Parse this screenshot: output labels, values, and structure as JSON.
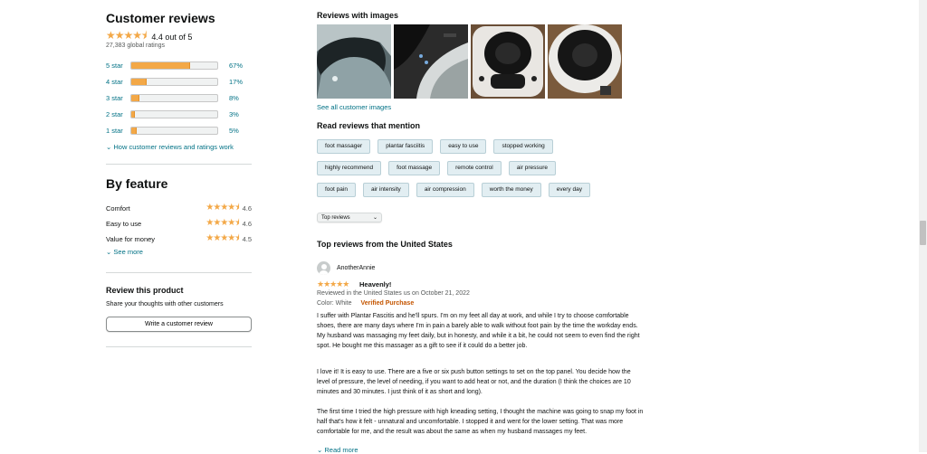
{
  "reviews": {
    "title": "Customer reviews",
    "rating_text": "4.4 out of 5",
    "rating": 4.4,
    "global_ratings": "27,383 global ratings",
    "histogram": [
      {
        "label": "5 star",
        "percent": 67,
        "pct_text": "67%"
      },
      {
        "label": "4 star",
        "percent": 17,
        "pct_text": "17%"
      },
      {
        "label": "3 star",
        "percent": 8,
        "pct_text": "8%"
      },
      {
        "label": "2 star",
        "percent": 3,
        "pct_text": "3%"
      },
      {
        "label": "1 star",
        "percent": 5,
        "pct_text": "5%"
      }
    ],
    "how_link": "How customer reviews and ratings work"
  },
  "by_feature": {
    "title": "By feature",
    "items": [
      {
        "name": "Comfort",
        "value": "4.6"
      },
      {
        "name": "Easy to use",
        "value": "4.6"
      },
      {
        "name": "Value for money",
        "value": "4.5"
      }
    ],
    "see_more": "See more"
  },
  "review_product": {
    "title": "Review this product",
    "subtitle": "Share your thoughts with other customers",
    "button": "Write a customer review"
  },
  "images_section": {
    "title": "Reviews with images",
    "see_all": "See all customer images"
  },
  "mentions": {
    "title": "Read reviews that mention",
    "rows": [
      [
        "foot massager",
        "plantar fasciitis",
        "easy to use",
        "stopped working"
      ],
      [
        "highly recommend",
        "foot massage",
        "remote control",
        "air pressure"
      ],
      [
        "foot pain",
        "air intensity",
        "air compression",
        "worth the money",
        "every day"
      ]
    ]
  },
  "sort": {
    "selected": "Top reviews"
  },
  "top_reviews": {
    "title": "Top reviews from the United States",
    "review": {
      "author": "AnotherAnnie",
      "stars": 5,
      "title": "Heavenly!",
      "date": "Reviewed in the United States us on October 21, 2022",
      "color": "Color: White",
      "verified": "Verified Purchase",
      "p1": "I suffer with Plantar Fascitis and he'll spurs. I'm on my feet all day at work, and while I try to choose comfortable shoes, there are many days where I'm in pain a barely able to walk without foot pain by the time the workday ends. My husband was massaging my feet daily, but in honesty, and while it a bit, he could not seem to even find the right spot. He bought me this massager as a gift to see if it could do a better job.",
      "p2": "I love it! It is easy to use. There are a five or six push button settings to set on the top panel. You decide how the level of pressure, the level of needing, if you want to add heat or not, and the duration (I think the choices are 10 minutes and 30 minutes. I just think of it as short and long).",
      "p3": "The first time I tried the high pressure with high kneading setting, I thought the machine was going to snap my foot in half that's how it felt - unnatural and uncomfortable. I stopped it and went for the lower setting. That was more comfortable for me, and the result was about the same as when my husband massages my feet.",
      "read_more": "Read more"
    }
  },
  "colors": {
    "star": "#f3a847",
    "link": "#007185",
    "verified": "#c45500"
  }
}
